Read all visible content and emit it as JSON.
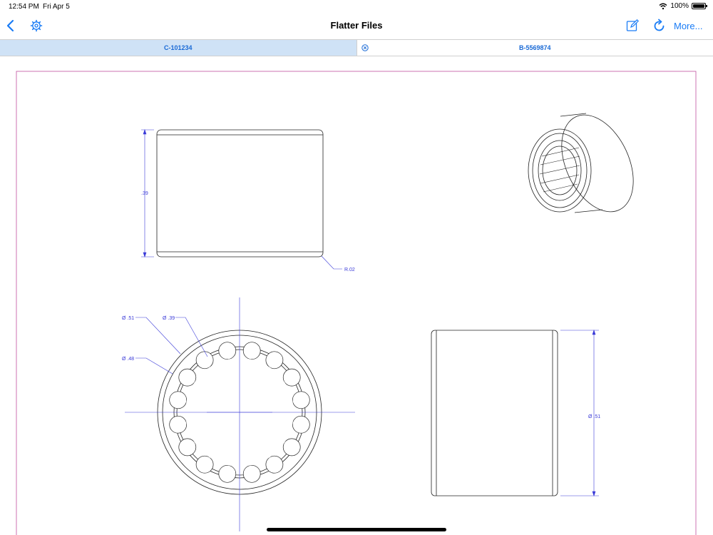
{
  "status": {
    "time": "12:54 PM",
    "date": "Fri Apr 5",
    "battery": "100%"
  },
  "nav": {
    "title": "Flatter Files",
    "more_label": "More...",
    "icons": {
      "back": "chevron-left-icon",
      "settings": "gear-icon",
      "edit": "edit-icon",
      "refresh": "refresh-icon"
    }
  },
  "tabs": [
    {
      "label": "C-101234",
      "active": true
    },
    {
      "label": "B-5569874",
      "active": false
    }
  ],
  "drawing": {
    "dimensions": {
      "height": ".39",
      "radius": "R.02",
      "outer_dia": "Ø .51",
      "inner_dia": "Ø .39",
      "mid_dia": "Ø .48",
      "side_dia": "Ø .51"
    },
    "colors": {
      "border": "#c050a0",
      "dimension": "#3a3ad8",
      "line": "#222222",
      "accent": "#1a7cf5"
    }
  }
}
